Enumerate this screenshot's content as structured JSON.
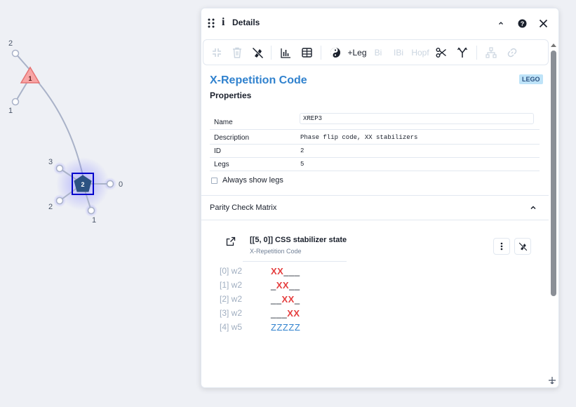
{
  "canvas": {
    "nodes": [
      {
        "id": "triangle-node",
        "label": "1",
        "shape": "triangle",
        "color": "#f8a5a5"
      },
      {
        "id": "pentagon-node",
        "label": "2",
        "shape": "pentagon",
        "color": "#2c5282",
        "selected": true
      }
    ],
    "legs": {
      "triangle_top": "2",
      "triangle_bottom": "1",
      "pentagon_right": "0",
      "pentagon_bottom": "1",
      "pentagon_left": "2",
      "pentagon_top": "3"
    }
  },
  "panel": {
    "title": "Details",
    "icons": {
      "drag": "drag-handle-icon",
      "info": "info-icon",
      "collapse": "chevron-up-icon",
      "help": "help-icon",
      "close": "close-icon"
    }
  },
  "toolbar": {
    "items": [
      {
        "icon": "collapse-icon",
        "enabled": false
      },
      {
        "icon": "trash-icon",
        "enabled": false
      },
      {
        "icon": "highlight-off-icon",
        "enabled": true
      },
      {
        "icon": "bar-chart-icon",
        "enabled": true
      },
      {
        "icon": "table-icon",
        "enabled": true
      },
      {
        "icon": "yin-yang-icon",
        "enabled": true
      },
      {
        "label": "+Leg",
        "enabled": true
      },
      {
        "label": "Bi",
        "enabled": false
      },
      {
        "label": "IBi",
        "enabled": false
      },
      {
        "label": "Hopf",
        "enabled": false
      },
      {
        "icon": "scissors-icon",
        "enabled": true
      },
      {
        "icon": "fork-icon",
        "enabled": true
      },
      {
        "icon": "hierarchy-icon",
        "enabled": false
      },
      {
        "icon": "link-icon",
        "enabled": false
      }
    ],
    "add_leg_label": "+Leg",
    "bi_label": "Bi",
    "ibi_label": "IBi",
    "hopf_label": "Hopf"
  },
  "lego": {
    "title": "X-Repetition Code",
    "badge": "LEGO",
    "properties_heading": "Properties",
    "properties": {
      "name_label": "Name",
      "name_value": "XREP3",
      "description_label": "Description",
      "description_value": "Phase flip code, XX stabilizers",
      "id_label": "ID",
      "id_value": "2",
      "legs_label": "Legs",
      "legs_value": "5"
    },
    "always_show_legs_label": "Always show legs",
    "always_show_legs_checked": false
  },
  "parity_check": {
    "heading": "Parity Check Matrix",
    "state_title": "[[5, 0]] CSS stabilizer state",
    "state_subtitle": "X-Repetition Code",
    "rows": [
      {
        "label": "[0] w2",
        "pauli": "XX___"
      },
      {
        "label": "[1] w2",
        "pauli": "_XX__"
      },
      {
        "label": "[2] w2",
        "pauli": "__XX_"
      },
      {
        "label": "[3] w2",
        "pauli": "___XX"
      },
      {
        "label": "[4] w5",
        "pauli": "ZZZZZ"
      }
    ]
  },
  "colors": {
    "accent": "#3182ce",
    "x_pauli": "#e53e3e",
    "z_pauli": "#3182ce",
    "triangle": "#f8a5a5",
    "pentagon": "#2c5282",
    "selection": "#0000cc"
  }
}
